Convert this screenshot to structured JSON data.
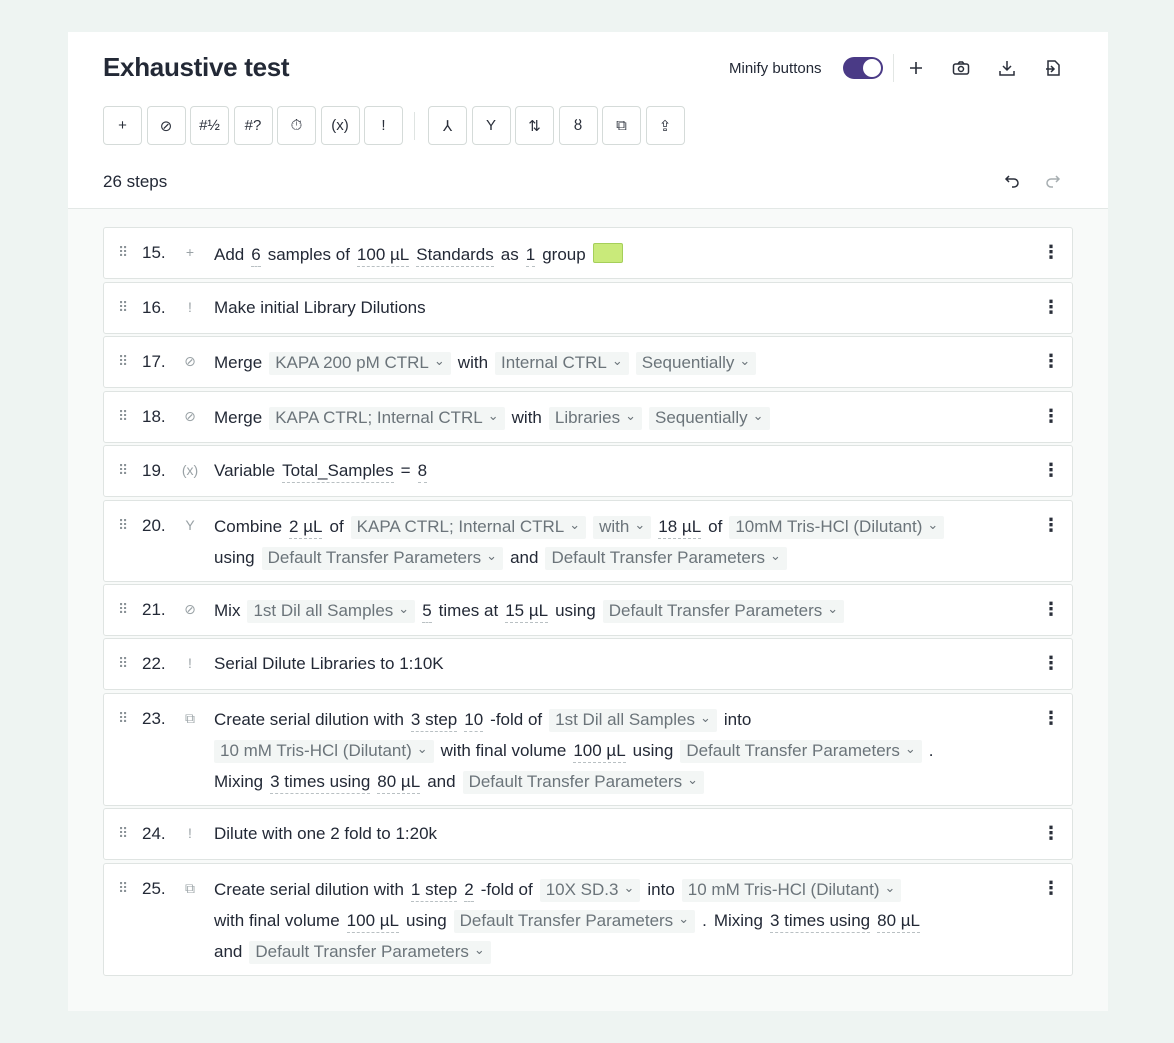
{
  "header": {
    "title": "Exhaustive test",
    "minify_label": "Minify buttons",
    "minify_on": true,
    "icons": [
      "plus-icon",
      "camera-icon",
      "download-icon",
      "export-icon"
    ]
  },
  "toolbar": {
    "buttons_left": [
      {
        "name": "add-step-icon",
        "glyph": "+"
      },
      {
        "name": "merge-icon",
        "glyph": "⊘"
      },
      {
        "name": "number-icon",
        "glyph": "#½"
      },
      {
        "name": "number-query-icon",
        "glyph": "#?"
      },
      {
        "name": "timer-icon",
        "glyph": "⏱"
      },
      {
        "name": "variable-icon",
        "glyph": "(x)"
      },
      {
        "name": "note-icon",
        "glyph": "!"
      }
    ],
    "buttons_right": [
      {
        "name": "split-icon",
        "glyph": "⅄"
      },
      {
        "name": "combine-icon",
        "glyph": "Y"
      },
      {
        "name": "sort-icon",
        "glyph": "⇅"
      },
      {
        "name": "mix-icon",
        "glyph": "ȣ"
      },
      {
        "name": "serial-dilution-icon",
        "glyph": "⧉"
      },
      {
        "name": "dispense-icon",
        "glyph": "⇪"
      }
    ]
  },
  "steps_summary": "26 steps",
  "steps": [
    {
      "num": "15.",
      "icon": "plus-icon",
      "glyph": "+",
      "lines": [
        [
          {
            "t": "Add",
            "k": "text"
          },
          {
            "t": "6",
            "k": "v"
          },
          {
            "t": "samples of",
            "k": "text"
          },
          {
            "t": "100 µL",
            "k": "v"
          },
          {
            "t": "Standards",
            "k": "v"
          },
          {
            "t": "as",
            "k": "text"
          },
          {
            "t": "1",
            "k": "v"
          },
          {
            "t": "group",
            "k": "text"
          },
          {
            "t": "",
            "k": "swatch"
          }
        ]
      ]
    },
    {
      "num": "16.",
      "icon": "note-icon",
      "glyph": "!",
      "lines": [
        [
          {
            "t": "Make initial Library Dilutions",
            "k": "text"
          }
        ]
      ]
    },
    {
      "num": "17.",
      "icon": "merge-icon",
      "glyph": "⊘",
      "lines": [
        [
          {
            "t": "Merge",
            "k": "text"
          },
          {
            "t": "KAPA 200 pM CTRL",
            "k": "dd"
          },
          {
            "t": "with",
            "k": "text"
          },
          {
            "t": "Internal CTRL",
            "k": "dd"
          },
          {
            "t": "Sequentially",
            "k": "dd"
          }
        ]
      ]
    },
    {
      "num": "18.",
      "icon": "merge-icon",
      "glyph": "⊘",
      "lines": [
        [
          {
            "t": "Merge",
            "k": "text"
          },
          {
            "t": "KAPA CTRL; Internal CTRL",
            "k": "dd"
          },
          {
            "t": "with",
            "k": "text"
          },
          {
            "t": "Libraries",
            "k": "dd"
          },
          {
            "t": "Sequentially",
            "k": "dd"
          }
        ]
      ]
    },
    {
      "num": "19.",
      "icon": "variable-icon",
      "glyph": "(x)",
      "lines": [
        [
          {
            "t": "Variable",
            "k": "text"
          },
          {
            "t": "Total_Samples",
            "k": "v"
          },
          {
            "t": "=",
            "k": "text"
          },
          {
            "t": "8",
            "k": "v"
          }
        ]
      ]
    },
    {
      "num": "20.",
      "icon": "combine-icon",
      "glyph": "Y",
      "lines": [
        [
          {
            "t": "Combine",
            "k": "text"
          },
          {
            "t": "2 µL",
            "k": "v"
          },
          {
            "t": "of",
            "k": "text"
          },
          {
            "t": "KAPA CTRL; Internal CTRL",
            "k": "dd"
          },
          {
            "t": "with",
            "k": "dd"
          },
          {
            "t": "18 µL",
            "k": "v"
          },
          {
            "t": "of",
            "k": "text"
          },
          {
            "t": "10mM Tris-HCl (Dilutant)",
            "k": "dd"
          }
        ],
        [
          {
            "t": "using",
            "k": "text"
          },
          {
            "t": "Default Transfer Parameters",
            "k": "dd"
          },
          {
            "t": "and",
            "k": "text"
          },
          {
            "t": "Default Transfer Parameters",
            "k": "dd"
          }
        ]
      ]
    },
    {
      "num": "21.",
      "icon": "mix-icon",
      "glyph": "⊘",
      "lines": [
        [
          {
            "t": "Mix",
            "k": "text"
          },
          {
            "t": "1st Dil all Samples",
            "k": "dd"
          },
          {
            "t": "5",
            "k": "v"
          },
          {
            "t": "times at",
            "k": "text"
          },
          {
            "t": "15 µL",
            "k": "v"
          },
          {
            "t": "using",
            "k": "text"
          },
          {
            "t": "Default Transfer Parameters",
            "k": "dd"
          }
        ]
      ]
    },
    {
      "num": "22.",
      "icon": "note-icon",
      "glyph": "!",
      "lines": [
        [
          {
            "t": "Serial Dilute Libraries to 1:10K",
            "k": "text"
          }
        ]
      ]
    },
    {
      "num": "23.",
      "icon": "serial-dilution-icon",
      "glyph": "⧉",
      "lines": [
        [
          {
            "t": "Create serial dilution with",
            "k": "text"
          },
          {
            "t": "3 step",
            "k": "v"
          },
          {
            "t": "10",
            "k": "v"
          },
          {
            "t": "-fold of",
            "k": "text"
          },
          {
            "t": "1st Dil all Samples",
            "k": "dd"
          },
          {
            "t": "into",
            "k": "text"
          }
        ],
        [
          {
            "t": "10 mM Tris-HCl (Dilutant)",
            "k": "dd"
          },
          {
            "t": "with final volume",
            "k": "text"
          },
          {
            "t": "100 µL",
            "k": "v"
          },
          {
            "t": "using",
            "k": "text"
          },
          {
            "t": "Default Transfer Parameters",
            "k": "dd"
          },
          {
            "t": ".",
            "k": "text"
          }
        ],
        [
          {
            "t": "Mixing",
            "k": "text"
          },
          {
            "t": "3 times using",
            "k": "v"
          },
          {
            "t": "80 µL",
            "k": "v"
          },
          {
            "t": "and",
            "k": "text"
          },
          {
            "t": "Default Transfer Parameters",
            "k": "dd"
          }
        ]
      ]
    },
    {
      "num": "24.",
      "icon": "note-icon",
      "glyph": "!",
      "lines": [
        [
          {
            "t": "Dilute with one 2 fold to 1:20k",
            "k": "text"
          }
        ]
      ]
    },
    {
      "num": "25.",
      "icon": "serial-dilution-icon",
      "glyph": "⧉",
      "lines": [
        [
          {
            "t": "Create serial dilution with",
            "k": "text"
          },
          {
            "t": "1 step",
            "k": "v"
          },
          {
            "t": "2",
            "k": "v"
          },
          {
            "t": "-fold of",
            "k": "text"
          },
          {
            "t": "10X SD.3",
            "k": "dd"
          },
          {
            "t": "into",
            "k": "text"
          },
          {
            "t": "10 mM Tris-HCl (Dilutant)",
            "k": "dd"
          }
        ],
        [
          {
            "t": "with final volume",
            "k": "text"
          },
          {
            "t": "100 µL",
            "k": "v"
          },
          {
            "t": "using",
            "k": "text"
          },
          {
            "t": "Default Transfer Parameters",
            "k": "dd"
          },
          {
            "t": ".",
            "k": "text"
          },
          {
            "t": "Mixing",
            "k": "text"
          },
          {
            "t": "3 times using",
            "k": "v"
          },
          {
            "t": "80 µL",
            "k": "v"
          }
        ],
        [
          {
            "t": "and",
            "k": "text"
          },
          {
            "t": "Default Transfer Parameters",
            "k": "dd"
          }
        ]
      ]
    }
  ],
  "colors": {
    "accent": "#4a3a86",
    "swatch": "#c9ea7a",
    "page_bg": "#eef4f2"
  }
}
